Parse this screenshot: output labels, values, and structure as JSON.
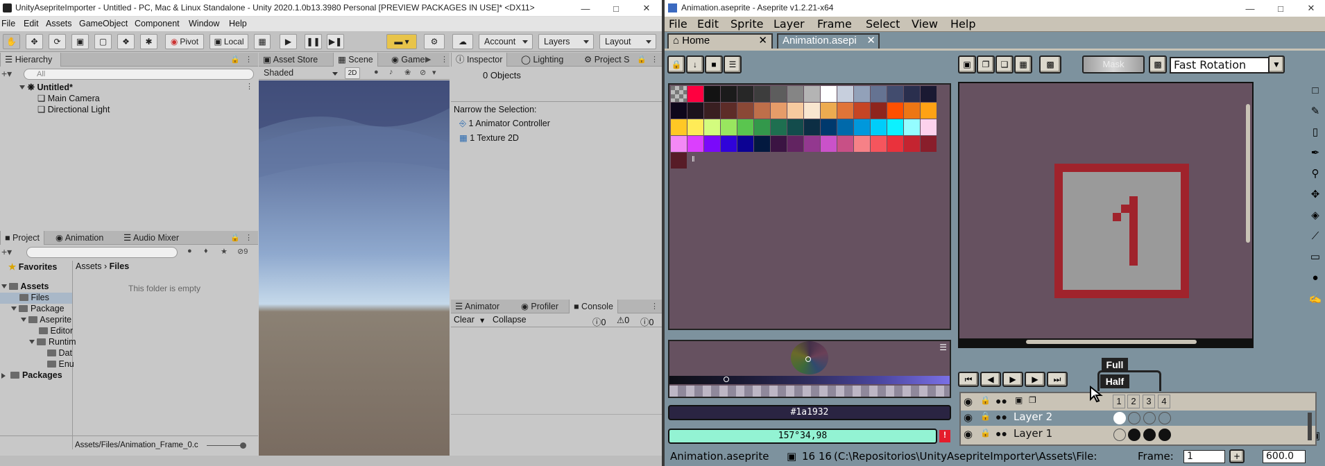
{
  "unity": {
    "title": "UnityAsepriteImporter - Untitled - PC, Mac & Linux Standalone - Unity 2020.1.0b13.3980 Personal [PREVIEW PACKAGES IN USE]* <DX11>",
    "menu": [
      "File",
      "Edit",
      "Assets",
      "GameObject",
      "Component",
      "Window",
      "Help"
    ],
    "toolbar": {
      "pivot": "Pivot",
      "local": "Local",
      "account": "Account",
      "layers": "Layers",
      "layout": "Layout"
    },
    "hierarchy": {
      "tab": "Hierarchy",
      "search_placeholder": "All",
      "scene": "Untitled*",
      "items": [
        "Main Camera",
        "Directional Light"
      ]
    },
    "scene": {
      "tabs": [
        "Asset Store",
        "Scene",
        "Game"
      ],
      "shading": "Shaded",
      "mode_2d": "2D"
    },
    "inspector": {
      "tabs": [
        "Inspector",
        "Lighting",
        "Project S"
      ],
      "objects": "0 Objects",
      "narrow_label": "Narrow the Selection:",
      "narrow_items": [
        "1 Animator Controller",
        "1 Texture 2D"
      ]
    },
    "project": {
      "tabs": [
        "Project",
        "Animation",
        "Audio Mixer"
      ],
      "hidden_count": "9",
      "favorites": "Favorites",
      "tree": [
        "Assets",
        "Files",
        "Package",
        "Aseprite",
        "Editor",
        "Runtim",
        "Dat",
        "Enu",
        "Packages"
      ],
      "breadcrumb": [
        "Assets",
        "Files"
      ],
      "empty_message": "This folder is empty",
      "selected_path": "Assets/Files/Animation_Frame_0.c"
    },
    "console": {
      "tabs": [
        "Animator",
        "Profiler",
        "Console"
      ],
      "clear": "Clear",
      "collapse": "Collapse",
      "counts": [
        "0",
        "0",
        "0"
      ]
    }
  },
  "aseprite": {
    "title": "Animation.aseprite - Aseprite v1.2.21-x64",
    "menu": [
      "File",
      "Edit",
      "Sprite",
      "Layer",
      "Frame",
      "Select",
      "View",
      "Help"
    ],
    "tabs": [
      "Home",
      "Animation.asepi"
    ],
    "mask_label": "Mask",
    "rotation_mode": "Fast Rotation",
    "hex_color": "#1a1932",
    "hsv_color": "157°34,98",
    "canvas_digit": "1",
    "onion_tooltip_full": "Full",
    "onion_tooltip_half": "Half",
    "frames": [
      "1",
      "2",
      "3",
      "4"
    ],
    "layers": [
      "Layer 2",
      "Layer 1"
    ],
    "status": {
      "filename": "Animation.aseprite",
      "size": "16 16",
      "path": "(C:\\Repositorios\\UnityAsepriteImporter\\Assets\\File:",
      "frame_label": "Frame:",
      "frame_value": "1",
      "zoom": "600.0"
    },
    "palette_colors": [
      "#000000",
      "#ff0040",
      "#131313",
      "#1b1b1b",
      "#272727",
      "#3d3d3d",
      "#5d5d5d",
      "#858585",
      "#b4b4b4",
      "#ffffff",
      "#c7cfdd",
      "#92a1b9",
      "#657392",
      "#424c6e",
      "#2a2f4e",
      "#1a1932",
      "#0e071b",
      "#1c121c",
      "#391f21",
      "#5d2c28",
      "#8a4836",
      "#bf6f4a",
      "#e69c69",
      "#f6ca9f",
      "#f9e6cf",
      "#edab50",
      "#e07438",
      "#c64524",
      "#8e251d",
      "#ff5000",
      "#ed7614",
      "#ffa214",
      "#ffc825",
      "#ffeb57",
      "#d3fc7e",
      "#99e65f",
      "#5ac54f",
      "#33984b",
      "#1e6f50",
      "#134c4c",
      "#0c2e44",
      "#00396d",
      "#0069aa",
      "#0098dc",
      "#00cdf9",
      "#0cf1ff",
      "#94fdff",
      "#fdd2ed",
      "#f389f5",
      "#db3ffd",
      "#7a09fa",
      "#3003d9",
      "#0c0293",
      "#03193f",
      "#3b1443",
      "#622461",
      "#93388f",
      "#ca52c9",
      "#c85086",
      "#f68187",
      "#f5555d",
      "#ea323c",
      "#c42430",
      "#891e2b",
      "#571c27"
    ]
  }
}
